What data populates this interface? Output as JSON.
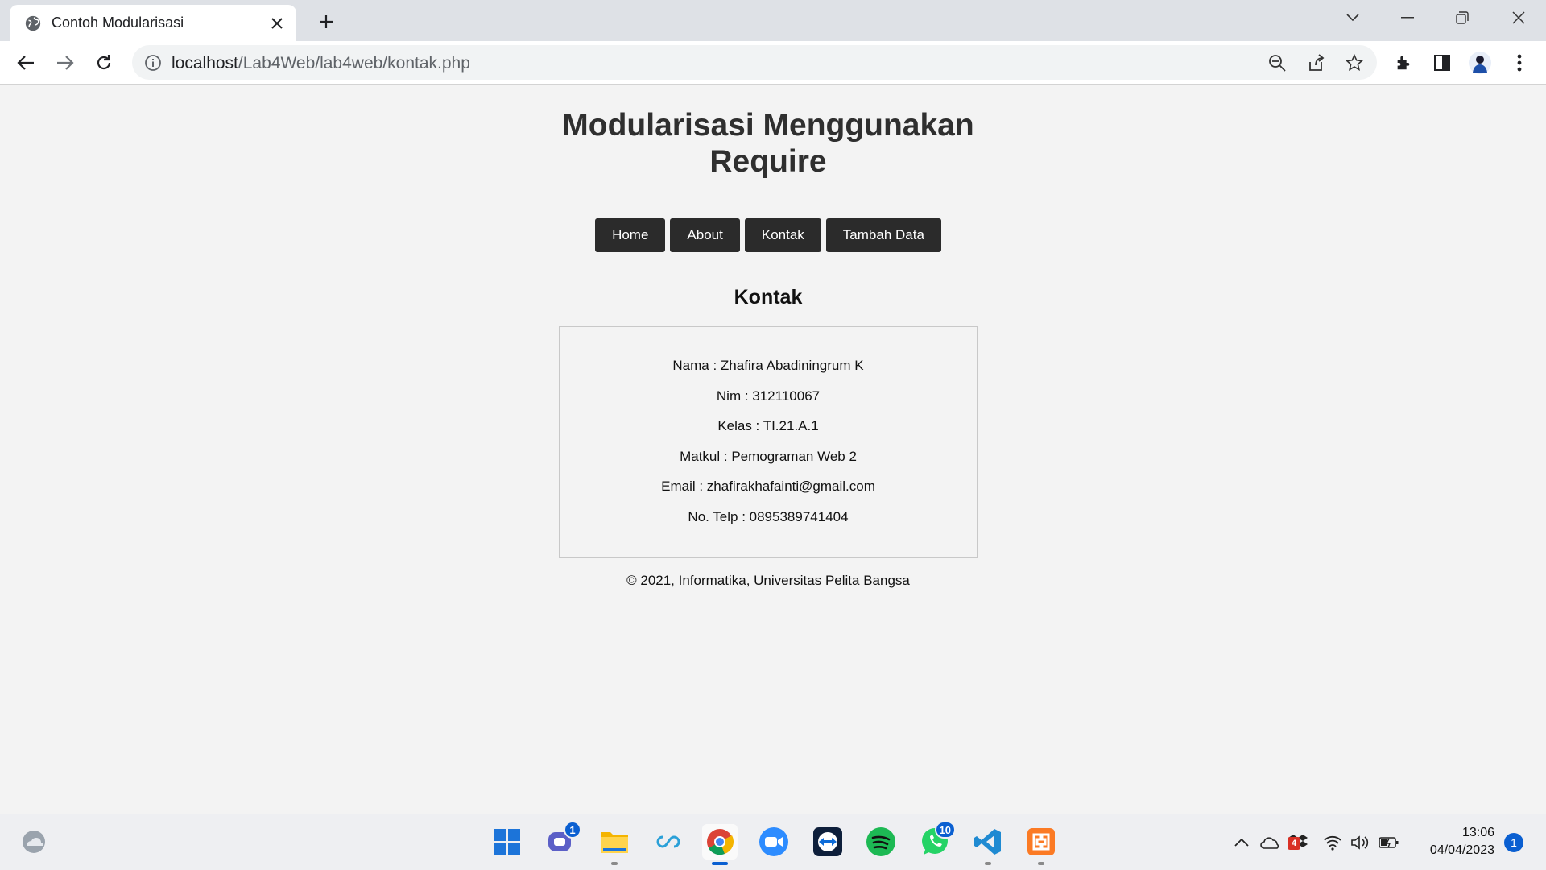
{
  "browser": {
    "tab_title": "Contoh Modularisasi",
    "url_host": "localhost",
    "url_path": "/Lab4Web/lab4web/kontak.php"
  },
  "page": {
    "site_title_line1": "Modularisasi Menggunakan",
    "site_title_line2": "Require",
    "nav": [
      {
        "label": "Home"
      },
      {
        "label": "About"
      },
      {
        "label": "Kontak"
      },
      {
        "label": "Tambah Data"
      }
    ],
    "section_title": "Kontak",
    "contact_lines": [
      "Nama : Zhafira Abadiningrum K",
      "Nim : 312110067",
      "Kelas : TI.21.A.1",
      "Matkul : Pemograman Web 2",
      "Email : zhafirakhafainti@gmail.com",
      "No. Telp : 0895389741404"
    ],
    "footer": "© 2021, Informatika, Universitas Pelita Bangsa"
  },
  "taskbar": {
    "teams_badge": "1",
    "whatsapp_badge": "10",
    "tray_dropbox_badge": "4",
    "time": "13:06",
    "date": "04/04/2023",
    "notification_count": "1"
  },
  "colors": {
    "nav_bg": "#2b2b2b",
    "page_bg": "#f3f3f3",
    "accent": "#0a5fd1"
  }
}
